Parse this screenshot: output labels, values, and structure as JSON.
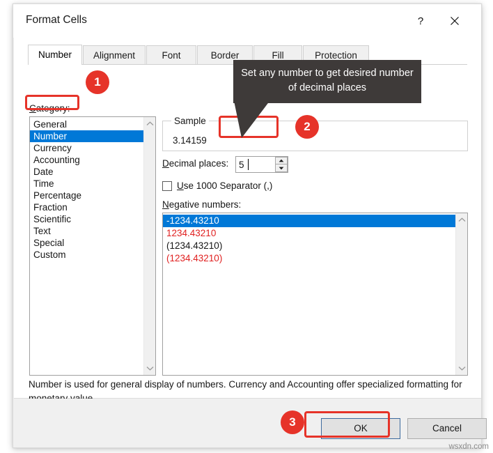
{
  "window": {
    "title": "Format Cells",
    "help_icon": "question-mark-icon",
    "close_icon": "close-x-icon"
  },
  "tabs": [
    {
      "label": "Number",
      "active": true
    },
    {
      "label": "Alignment",
      "active": false
    },
    {
      "label": "Font",
      "active": false
    },
    {
      "label": "Border",
      "active": false
    },
    {
      "label": "Fill",
      "active": false
    },
    {
      "label": "Protection",
      "active": false
    }
  ],
  "category": {
    "label": "Category:",
    "items": [
      "General",
      "Number",
      "Currency",
      "Accounting",
      "Date",
      "Time",
      "Percentage",
      "Fraction",
      "Scientific",
      "Text",
      "Special",
      "Custom"
    ],
    "selected": "Number"
  },
  "sample": {
    "legend": "Sample",
    "value": "3.14159"
  },
  "decimal_places": {
    "label": "Decimal places:",
    "value": "5",
    "spinner_up_icon": "triangle-up-icon",
    "spinner_down_icon": "triangle-down-icon"
  },
  "thousands_separator": {
    "label": "Use 1000 Separator (,)",
    "checked": false
  },
  "negative_numbers": {
    "label": "Negative numbers:",
    "items": [
      {
        "text": "-1234.43210",
        "color": "black",
        "selected": true
      },
      {
        "text": "1234.43210",
        "color": "red",
        "selected": false
      },
      {
        "text": "(1234.43210)",
        "color": "black",
        "selected": false
      },
      {
        "text": "(1234.43210)",
        "color": "red",
        "selected": false
      }
    ]
  },
  "description": "Number is used for general display of numbers.  Currency and Accounting offer specialized formatting for monetary value.",
  "footer": {
    "ok_label": "OK",
    "cancel_label": "Cancel"
  },
  "annotations": {
    "badge_1": "1",
    "badge_2": "2",
    "badge_3": "3",
    "callout_text": "Set any number to get desired number of decimal places",
    "highlight_color": "#e63329",
    "callout_bg": "#3e3a39"
  },
  "colors": {
    "selection_blue": "#0078d7",
    "negative_red": "#e02020",
    "dialog_bg": "#f0f0f0"
  },
  "watermark": "wsxdn.com"
}
